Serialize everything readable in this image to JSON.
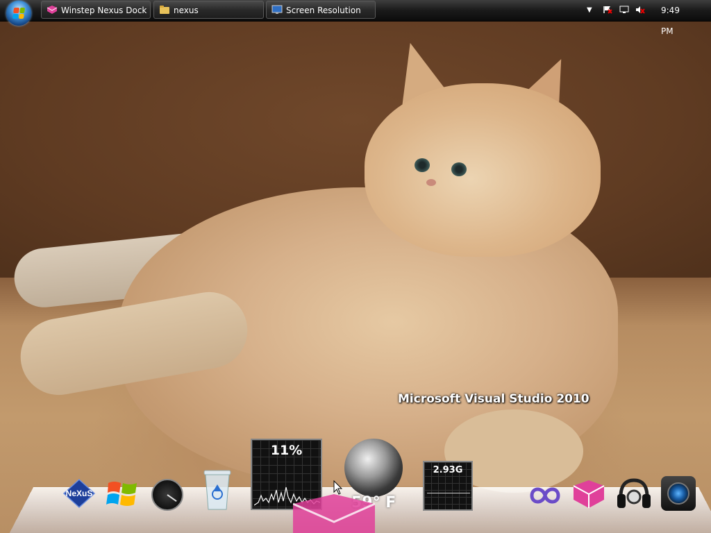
{
  "taskbar": {
    "buttons": [
      {
        "label": "Winstep Nexus Dock ...",
        "icon": "nexus-dock-icon"
      },
      {
        "label": "nexus",
        "icon": "folder-icon"
      },
      {
        "label": "Screen Resolution",
        "icon": "display-icon"
      }
    ],
    "tray": {
      "chevron": "▼",
      "icons": [
        "flag-alert-icon",
        "network-icon",
        "volume-muted-icon"
      ],
      "clock": "9:49 PM"
    }
  },
  "desktop": {
    "shortcut_label": "Microsoft Visual Studio 2010"
  },
  "dock": {
    "items": [
      {
        "name": "nexus-logo",
        "label": "NeXuS"
      },
      {
        "name": "windows-logo"
      },
      {
        "name": "clock-widget"
      },
      {
        "name": "recycle-bin"
      },
      {
        "name": "cpu-meter",
        "value": "11%"
      },
      {
        "name": "weather-widget",
        "value": "59° F"
      },
      {
        "name": "memory-meter",
        "value": "2.93G"
      },
      {
        "name": "visual-studio-icon"
      },
      {
        "name": "nexus-dock-icon"
      },
      {
        "name": "headphones-icon"
      },
      {
        "name": "camera-icon"
      }
    ]
  },
  "colors": {
    "taskbar": "#1a1a1a",
    "accent_pink": "#e0409a",
    "dock_shelf": "#e6e6ec"
  }
}
